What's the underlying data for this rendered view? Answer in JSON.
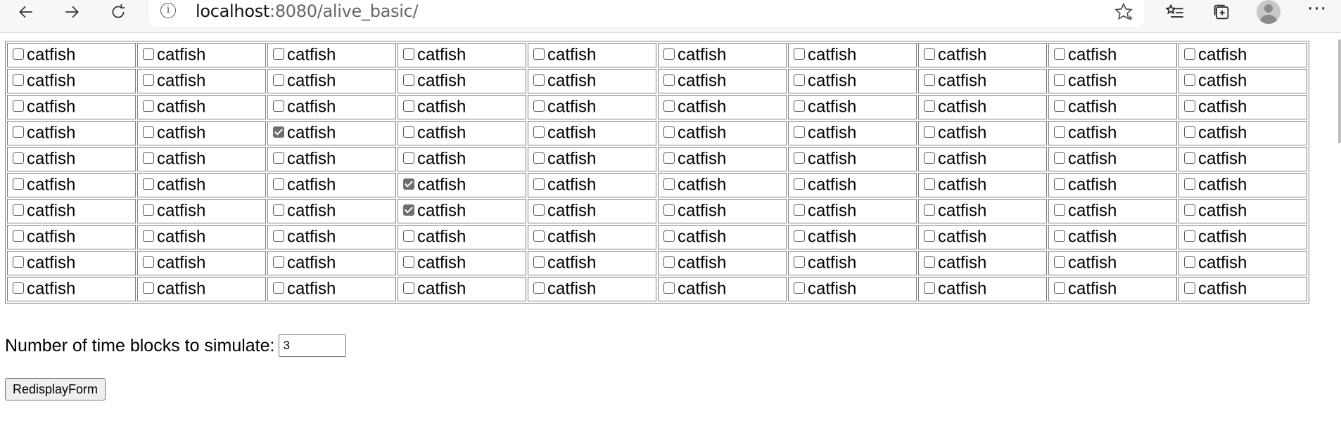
{
  "browser": {
    "url_host": "localhost",
    "url_rest": ":8080/alive_basic/",
    "icons": [
      "back-arrow-icon",
      "forward-arrow-icon",
      "refresh-icon",
      "info-icon",
      "star-icon",
      "favorites-icon",
      "collections-icon",
      "profile-avatar-icon",
      "more-menu-icon"
    ]
  },
  "grid": {
    "rows": [
      [
        {
          "label": "catfish",
          "checked": false
        },
        {
          "label": "catfish",
          "checked": false
        },
        {
          "label": "catfish",
          "checked": false
        },
        {
          "label": "catfish",
          "checked": false
        },
        {
          "label": "catfish",
          "checked": false
        },
        {
          "label": "catfish",
          "checked": false
        },
        {
          "label": "catfish",
          "checked": false
        },
        {
          "label": "catfish",
          "checked": false
        },
        {
          "label": "catfish",
          "checked": false
        },
        {
          "label": "catfish",
          "checked": false
        }
      ],
      [
        {
          "label": "catfish",
          "checked": false
        },
        {
          "label": "catfish",
          "checked": false
        },
        {
          "label": "catfish",
          "checked": false
        },
        {
          "label": "catfish",
          "checked": false
        },
        {
          "label": "catfish",
          "checked": false
        },
        {
          "label": "catfish",
          "checked": false
        },
        {
          "label": "catfish",
          "checked": false
        },
        {
          "label": "catfish",
          "checked": false
        },
        {
          "label": "catfish",
          "checked": false
        },
        {
          "label": "catfish",
          "checked": false
        }
      ],
      [
        {
          "label": "catfish",
          "checked": false
        },
        {
          "label": "catfish",
          "checked": false
        },
        {
          "label": "catfish",
          "checked": false
        },
        {
          "label": "catfish",
          "checked": false
        },
        {
          "label": "catfish",
          "checked": false
        },
        {
          "label": "catfish",
          "checked": false
        },
        {
          "label": "catfish",
          "checked": false
        },
        {
          "label": "catfish",
          "checked": false
        },
        {
          "label": "catfish",
          "checked": false
        },
        {
          "label": "catfish",
          "checked": false
        }
      ],
      [
        {
          "label": "catfish",
          "checked": false
        },
        {
          "label": "catfish",
          "checked": false
        },
        {
          "label": "catfish",
          "checked": true
        },
        {
          "label": "catfish",
          "checked": false
        },
        {
          "label": "catfish",
          "checked": false
        },
        {
          "label": "catfish",
          "checked": false
        },
        {
          "label": "catfish",
          "checked": false
        },
        {
          "label": "catfish",
          "checked": false
        },
        {
          "label": "catfish",
          "checked": false
        },
        {
          "label": "catfish",
          "checked": false
        }
      ],
      [
        {
          "label": "catfish",
          "checked": false
        },
        {
          "label": "catfish",
          "checked": false
        },
        {
          "label": "catfish",
          "checked": false
        },
        {
          "label": "catfish",
          "checked": false
        },
        {
          "label": "catfish",
          "checked": false
        },
        {
          "label": "catfish",
          "checked": false
        },
        {
          "label": "catfish",
          "checked": false
        },
        {
          "label": "catfish",
          "checked": false
        },
        {
          "label": "catfish",
          "checked": false
        },
        {
          "label": "catfish",
          "checked": false
        }
      ],
      [
        {
          "label": "catfish",
          "checked": false
        },
        {
          "label": "catfish",
          "checked": false
        },
        {
          "label": "catfish",
          "checked": false
        },
        {
          "label": "catfish",
          "checked": true
        },
        {
          "label": "catfish",
          "checked": false
        },
        {
          "label": "catfish",
          "checked": false
        },
        {
          "label": "catfish",
          "checked": false
        },
        {
          "label": "catfish",
          "checked": false
        },
        {
          "label": "catfish",
          "checked": false
        },
        {
          "label": "catfish",
          "checked": false
        }
      ],
      [
        {
          "label": "catfish",
          "checked": false
        },
        {
          "label": "catfish",
          "checked": false
        },
        {
          "label": "catfish",
          "checked": false
        },
        {
          "label": "catfish",
          "checked": true
        },
        {
          "label": "catfish",
          "checked": false
        },
        {
          "label": "catfish",
          "checked": false
        },
        {
          "label": "catfish",
          "checked": false
        },
        {
          "label": "catfish",
          "checked": false
        },
        {
          "label": "catfish",
          "checked": false
        },
        {
          "label": "catfish",
          "checked": false
        }
      ],
      [
        {
          "label": "catfish",
          "checked": false
        },
        {
          "label": "catfish",
          "checked": false
        },
        {
          "label": "catfish",
          "checked": false
        },
        {
          "label": "catfish",
          "checked": false
        },
        {
          "label": "catfish",
          "checked": false
        },
        {
          "label": "catfish",
          "checked": false
        },
        {
          "label": "catfish",
          "checked": false
        },
        {
          "label": "catfish",
          "checked": false
        },
        {
          "label": "catfish",
          "checked": false
        },
        {
          "label": "catfish",
          "checked": false
        }
      ],
      [
        {
          "label": "catfish",
          "checked": false
        },
        {
          "label": "catfish",
          "checked": false
        },
        {
          "label": "catfish",
          "checked": false
        },
        {
          "label": "catfish",
          "checked": false
        },
        {
          "label": "catfish",
          "checked": false
        },
        {
          "label": "catfish",
          "checked": false
        },
        {
          "label": "catfish",
          "checked": false
        },
        {
          "label": "catfish",
          "checked": false
        },
        {
          "label": "catfish",
          "checked": false
        },
        {
          "label": "catfish",
          "checked": false
        }
      ],
      [
        {
          "label": "catfish",
          "checked": false
        },
        {
          "label": "catfish",
          "checked": false
        },
        {
          "label": "catfish",
          "checked": false
        },
        {
          "label": "catfish",
          "checked": false
        },
        {
          "label": "catfish",
          "checked": false
        },
        {
          "label": "catfish",
          "checked": false
        },
        {
          "label": "catfish",
          "checked": false
        },
        {
          "label": "catfish",
          "checked": false
        },
        {
          "label": "catfish",
          "checked": false
        },
        {
          "label": "catfish",
          "checked": false
        }
      ]
    ]
  },
  "form": {
    "time_blocks_label": "Number of time blocks to simulate:",
    "time_blocks_value": "3",
    "redisplay_button_label": "RedisplayForm"
  }
}
